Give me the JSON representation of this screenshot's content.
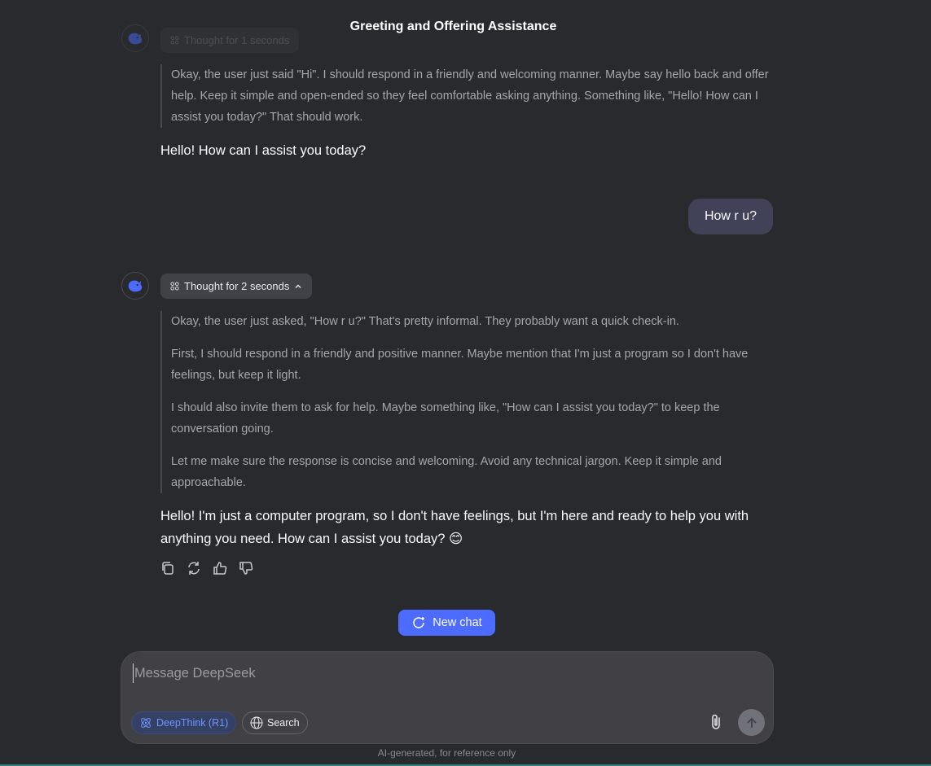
{
  "header": {
    "title": "Greeting and Offering Assistance"
  },
  "messages": {
    "first": {
      "thought_label": "Thought for 1 seconds",
      "thinking": "Okay, the user just said \"Hi\". I should respond in a friendly and welcoming manner. Maybe say hello back and offer help. Keep it simple and open-ended so they feel comfortable asking anything. Something like, \"Hello! How can I assist you today?\" That should work.",
      "answer": "Hello! How can I assist you today?"
    },
    "user": {
      "text": "How r u?"
    },
    "second": {
      "thought_label": "Thought for 2 seconds",
      "thinking": [
        "Okay, the user just asked, \"How r u?\" That's pretty informal. They probably want a quick check-in.",
        "First, I should respond in a friendly and positive manner. Maybe mention that I'm just a program so I don't have feelings, but keep it light.",
        "I should also invite them to ask for help. Maybe something like, \"How can I assist you today?\" to keep the conversation going.",
        "Let me make sure the response is concise and welcoming. Avoid any technical jargon. Keep it simple and approachable."
      ],
      "answer": "Hello! I'm just a computer program, so I don't have feelings, but I'm here and ready to help you with anything you need. How can I assist you today? 😊"
    }
  },
  "actions": {
    "icons": [
      "copy-icon",
      "regenerate-icon",
      "thumbs-up-icon",
      "thumbs-down-icon"
    ]
  },
  "new_chat": {
    "label": "New chat"
  },
  "composer": {
    "placeholder": "Message DeepSeek",
    "deepthink_label": "DeepThink (R1)",
    "search_label": "Search"
  },
  "footer": {
    "disclaimer": "AI-generated, for reference only"
  },
  "colors": {
    "accent": "#4d6bfe",
    "background": "#292a2d",
    "user_bubble": "#414158"
  }
}
